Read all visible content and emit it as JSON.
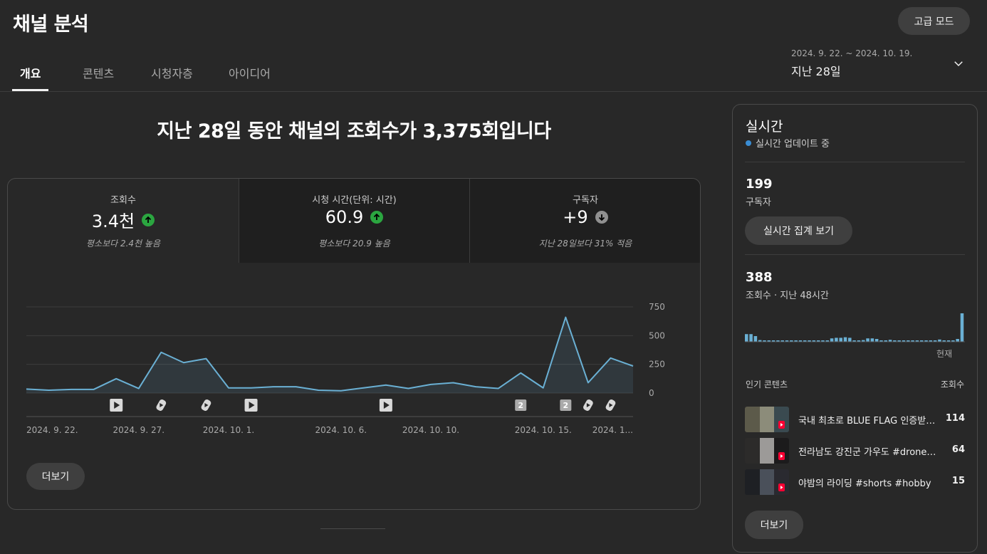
{
  "header": {
    "title": "채널 분석",
    "advanced_button": "고급 모드",
    "tabs": [
      {
        "label": "개요",
        "active": true
      },
      {
        "label": "콘텐츠",
        "active": false
      },
      {
        "label": "시청자층",
        "active": false
      },
      {
        "label": "아이디어",
        "active": false
      }
    ],
    "date_range": "2024. 9. 22. ~ 2024. 10. 19.",
    "date_label": "지난 28일"
  },
  "headline": "지난 28일 동안 채널의 조회수가 3,375회입니다",
  "metrics": [
    {
      "label": "조회수",
      "value": "3.4천",
      "trend": "up",
      "sub": "평소보다 2.4천 높음"
    },
    {
      "label": "시청 시간(단위: 시간)",
      "value": "60.9",
      "trend": "up",
      "sub": "평소보다 20.9 높음"
    },
    {
      "label": "구독자",
      "value": "+9",
      "trend": "down",
      "sub": "지난 28일보다 31% 적음"
    }
  ],
  "colors": {
    "line": "#6ab0d4",
    "trend_up": "#2ba640",
    "trend_down": "#909090"
  },
  "chart_data": {
    "type": "area",
    "x": [
      "2024-09-22",
      "2024-09-23",
      "2024-09-24",
      "2024-09-25",
      "2024-09-26",
      "2024-09-27",
      "2024-09-28",
      "2024-09-29",
      "2024-09-30",
      "2024-10-01",
      "2024-10-02",
      "2024-10-03",
      "2024-10-04",
      "2024-10-05",
      "2024-10-06",
      "2024-10-07",
      "2024-10-08",
      "2024-10-09",
      "2024-10-10",
      "2024-10-11",
      "2024-10-12",
      "2024-10-13",
      "2024-10-14",
      "2024-10-15",
      "2024-10-16",
      "2024-10-17",
      "2024-10-18",
      "2024-10-19"
    ],
    "series": [
      {
        "values": [
          35,
          25,
          32,
          32,
          125,
          40,
          355,
          265,
          300,
          45,
          45,
          55,
          55,
          25,
          20,
          45,
          70,
          40,
          75,
          90,
          55,
          40,
          175,
          45,
          660,
          90,
          305,
          235
        ]
      }
    ],
    "ylim": [
      0,
      750
    ],
    "y_ticks": [
      "750",
      "500",
      "250",
      "0"
    ],
    "x_tick_labels": [
      {
        "date": "2024-09-22",
        "label": "2024. 9. 22."
      },
      {
        "date": "2024-09-27",
        "label": "2024. 9. 27."
      },
      {
        "date": "2024-10-01",
        "label": "2024. 10. 1."
      },
      {
        "date": "2024-10-06",
        "label": "2024. 10. 6."
      },
      {
        "date": "2024-10-10",
        "label": "2024. 10. 10."
      },
      {
        "date": "2024-10-15",
        "label": "2024. 10. 15."
      },
      {
        "date": "2024-10-19",
        "label": "2024. 1..."
      }
    ],
    "markers": [
      {
        "date": "2024-09-26",
        "icon": "video-icon"
      },
      {
        "date": "2024-09-28",
        "icon": "shorts-icon"
      },
      {
        "date": "2024-09-30",
        "icon": "shorts-icon"
      },
      {
        "date": "2024-10-02",
        "icon": "video-icon"
      },
      {
        "date": "2024-10-08",
        "icon": "video-icon"
      },
      {
        "date": "2024-10-14",
        "icon": "count-badge",
        "label": "2"
      },
      {
        "date": "2024-10-16",
        "icon": "count-badge",
        "label": "2"
      },
      {
        "date": "2024-10-17",
        "icon": "shorts-icon"
      },
      {
        "date": "2024-10-18",
        "icon": "shorts-icon"
      }
    ],
    "grid": true
  },
  "more_button": "더보기",
  "realtime": {
    "title": "실시간",
    "status": "실시간 업데이트 중",
    "subscribers": "199",
    "subscribers_label": "구독자",
    "aggregate_button": "실시간 집계 보기",
    "views": "388",
    "views_label": "조회수 · 지난 48시간",
    "now_label": "현재",
    "bars": [
      0.27,
      0.27,
      0.2,
      0.06,
      0.03,
      0.03,
      0.05,
      0.05,
      0.03,
      0.04,
      0.03,
      0.03,
      0.03,
      0.03,
      0.03,
      0.03,
      0.03,
      0.03,
      0.03,
      0.12,
      0.14,
      0.14,
      0.16,
      0.14,
      0.04,
      0.03,
      0.06,
      0.12,
      0.12,
      0.1,
      0.04,
      0.04,
      0.07,
      0.05,
      0.05,
      0.05,
      0.05,
      0.05,
      0.05,
      0.03,
      0.03,
      0.03,
      0.03,
      0.08,
      0.05,
      0.05,
      0.05,
      0.1,
      1.0
    ],
    "popular_label": "인기 콘텐츠",
    "popular_metric": "조회수",
    "popular": [
      {
        "title": "국내 최초로 BLUE FLAG 인증받은 해수욕장 #shorts",
        "count": "114"
      },
      {
        "title": "전라남도 강진군 가우도 #drone #shorts",
        "count": "64"
      },
      {
        "title": "야밤의 라이딩 #shorts #hobby",
        "count": "15"
      }
    ],
    "more_button": "더보기"
  }
}
